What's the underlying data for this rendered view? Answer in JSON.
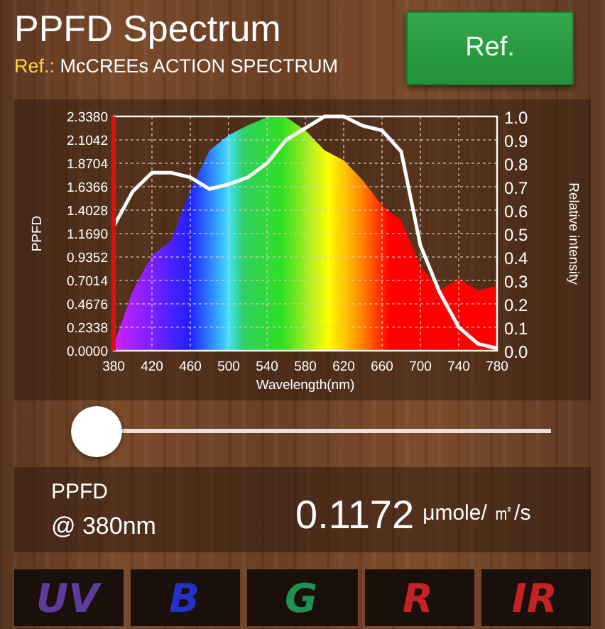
{
  "title": "PPFD Spectrum",
  "reference": {
    "label": "Ref.:",
    "name": "McCREEs ACTION SPECTRUM"
  },
  "ref_button": "Ref.",
  "chart": {
    "chart_data": {
      "type": "area",
      "xlabel": "Wavelength(nm)",
      "ylabel": "PPFD",
      "y2label": "Relative intensity",
      "grid": true,
      "y2lim": [
        0,
        1
      ],
      "x": [
        380,
        400,
        420,
        440,
        460,
        480,
        500,
        520,
        540,
        560,
        580,
        600,
        620,
        640,
        660,
        680,
        700,
        720,
        740,
        760,
        780
      ],
      "series": [
        {
          "color": "#ff0000",
          "values": [
            0.05,
            0.6,
            0.95,
            1.1,
            1.6,
            2.0,
            2.15,
            2.25,
            2.33,
            2.33,
            2.2,
            2.0,
            1.9,
            1.7,
            1.45,
            1.3,
            0.85,
            0.6,
            0.72,
            0.6,
            0.65
          ]
        },
        {
          "type": "line",
          "axis": "y2",
          "color": "#ffffff",
          "values": [
            0.53,
            0.68,
            0.76,
            0.76,
            0.74,
            0.69,
            0.71,
            0.74,
            0.8,
            0.9,
            0.95,
            1.0,
            1.0,
            0.96,
            0.94,
            0.85,
            0.45,
            0.25,
            0.1,
            0.03,
            0.01
          ]
        }
      ],
      "xlim": [
        380,
        780
      ],
      "ylim": [
        0,
        2.338
      ],
      "xticks": [
        380,
        420,
        460,
        500,
        540,
        580,
        620,
        660,
        700,
        740,
        780
      ],
      "yticks": [
        {
          "value": 0,
          "label": "0.0000"
        },
        {
          "value": 0.2338,
          "label": "0.2338"
        },
        {
          "value": 0.4676,
          "label": "0.4676"
        },
        {
          "value": 0.7014,
          "label": "0.7014"
        },
        {
          "value": 0.9352,
          "label": "0.9352"
        },
        {
          "value": 1.169,
          "label": "1.1690"
        },
        {
          "value": 1.4028,
          "label": "1.4028"
        },
        {
          "value": 1.6366,
          "label": "1.6366"
        },
        {
          "value": 1.8704,
          "label": "1.8704"
        },
        {
          "value": 2.1042,
          "label": "2.1042"
        },
        {
          "value": 2.338,
          "label": "2.3380"
        }
      ],
      "y2ticks": [
        {
          "value": 0,
          "label": "0.0"
        },
        {
          "value": 0.1,
          "label": "0.1"
        },
        {
          "value": 0.2,
          "label": "0.2"
        },
        {
          "value": 0.3,
          "label": "0.3"
        },
        {
          "value": 0.4,
          "label": "0.4"
        },
        {
          "value": 0.5,
          "label": "0.5"
        },
        {
          "value": 0.6,
          "label": "0.6"
        },
        {
          "value": 0.7,
          "label": "0.7"
        },
        {
          "value": 0.8,
          "label": "0.8"
        },
        {
          "value": 0.9,
          "label": "0.9"
        },
        {
          "value": 1.0,
          "label": "1.0"
        }
      ]
    }
  },
  "slider": {
    "level": 0
  },
  "readout": {
    "label": "PPFD",
    "wavelength": "@ 380nm",
    "value": "0.1172",
    "unit": "μmole/ ㎡/s"
  },
  "bands": [
    {
      "label": "UV",
      "color": "#5b3c9c"
    },
    {
      "label": "B",
      "color": "#2331c8"
    },
    {
      "label": "G",
      "color": "#1f9150"
    },
    {
      "label": "R",
      "color": "#c42326"
    },
    {
      "label": "IR",
      "color": "#c42326"
    }
  ]
}
